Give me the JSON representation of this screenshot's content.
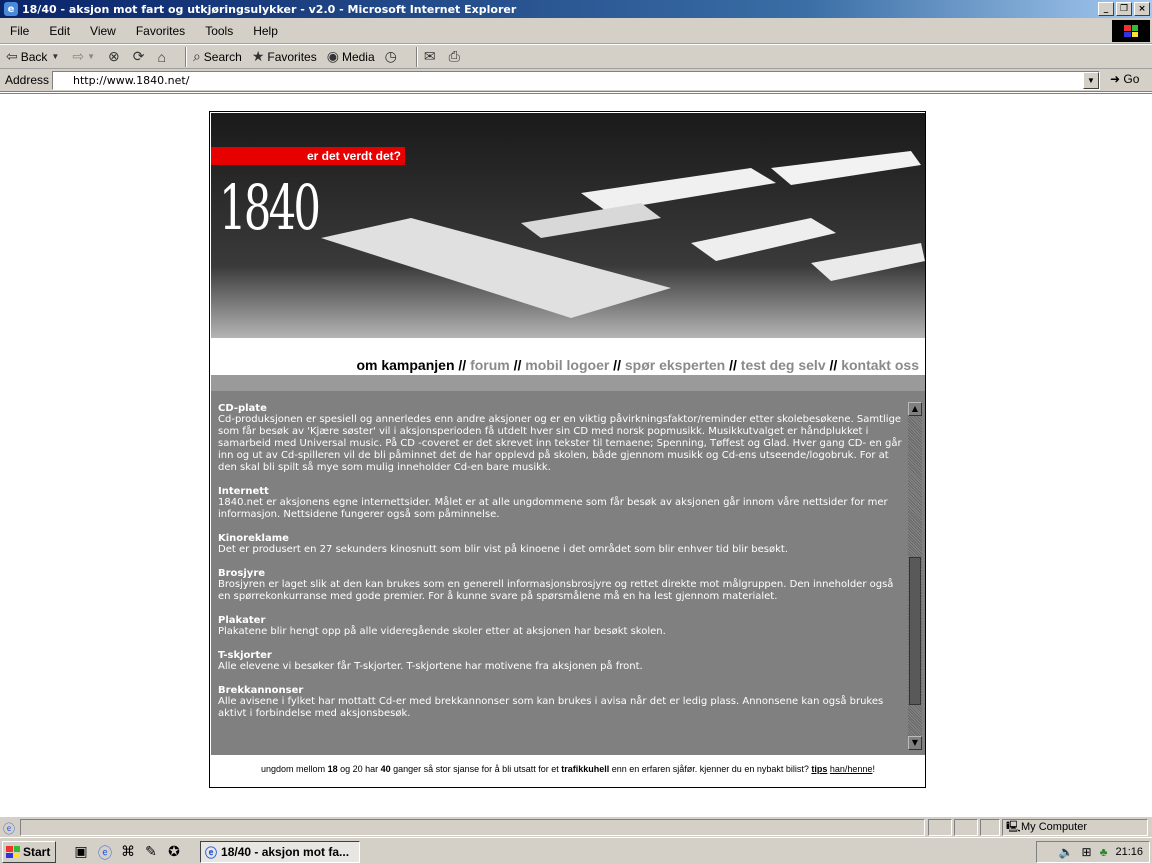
{
  "window": {
    "title": "18/40 - aksjon mot fart og utkjøringsulykker - v2.0 - Microsoft Internet Explorer",
    "controls": {
      "minimize": "_",
      "maximize": "❐",
      "close": "×"
    }
  },
  "menu": [
    "File",
    "Edit",
    "View",
    "Favorites",
    "Tools",
    "Help"
  ],
  "toolbar": {
    "back": "Back",
    "search": "Search",
    "favorites": "Favorites",
    "media": "Media"
  },
  "address": {
    "label": "Address",
    "url": "http://www.1840.net/",
    "go": "Go"
  },
  "site": {
    "slogan": "er det verdt det?",
    "logo": "1840",
    "nav": [
      {
        "label": "om kampanjen",
        "active": true
      },
      {
        "label": "forum",
        "active": false
      },
      {
        "label": "mobil logoer",
        "active": false
      },
      {
        "label": "spør eksperten",
        "active": false
      },
      {
        "label": "test deg selv",
        "active": false
      },
      {
        "label": "kontakt oss",
        "active": false
      }
    ],
    "nav_separator": "//",
    "sections": [
      {
        "title": "CD-plate",
        "body": "Cd-produksjonen er spesiell og annerledes enn andre aksjoner og er en viktig påvirkningsfaktor/reminder etter skolebesøkene. Samtlige som får besøk av 'Kjære søster' vil i aksjonsperioden få utdelt hver sin CD med norsk popmusikk. Musikkutvalget er håndplukket i samarbeid med Universal music. På CD -coveret er det skrevet inn tekster til temaene; Spenning, Tøffest og Glad. Hver gang CD- en går inn og ut av Cd-spilleren vil de bli påminnet det de har opplevd på skolen, både gjennom musikk og Cd-ens utseende/logobruk. For at den skal bli spilt så mye som mulig inneholder Cd-en bare musikk."
      },
      {
        "title": "Internett",
        "body": "1840.net er aksjonens egne internettsider. Målet er at alle ungdommene som får besøk av aksjonen går innom våre nettsider for mer informasjon. Nettsidene fungerer også som påminnelse."
      },
      {
        "title": "Kinoreklame",
        "body": "Det er produsert en 27 sekunders kinosnutt som blir vist på kinoene i det området som blir enhver tid blir besøkt."
      },
      {
        "title": "Brosjyre",
        "body": "Brosjyren er laget slik at den kan brukes som en generell informasjonsbrosjyre og rettet direkte mot målgruppen. Den inneholder også en spørrekonkurranse med gode premier. For å kunne svare på spørsmålene må en ha lest gjennom materialet."
      },
      {
        "title": "Plakater",
        "body": "Plakatene blir hengt opp på alle videregående skoler etter at aksjonen har besøkt skolen."
      },
      {
        "title": "T-skjorter",
        "body": "Alle elevene vi besøker får T-skjorter. T-skjortene har motivene fra aksjonen på front."
      },
      {
        "title": "Brekkannonser",
        "body": "Alle avisene i fylket har mottatt Cd-er med brekkannonser som kan brukes i avisa når det er ledig plass. Annonsene kan også brukes aktivt i forbindelse med aksjonsbesøk."
      }
    ],
    "footer": {
      "t1": "ungdom mellom ",
      "b1": "18",
      "t2": " og 20 har ",
      "b2": "40",
      "t3": " ganger så stor sjanse for å bli utsatt for et ",
      "b3": "trafikkuhell",
      "t4": " enn en erfaren sjåfør. kjenner du en nybakt bilist? ",
      "link1": "tips",
      "link2": "han/henne",
      "t5": "!"
    }
  },
  "status": {
    "zone": "My Computer"
  },
  "taskbar": {
    "start": "Start",
    "task": "18/40 - aksjon mot fa...",
    "clock": "21:16"
  },
  "colors": {
    "accent_red": "#e60000",
    "content_bg": "#808080",
    "nav_active": "#000000",
    "nav_inactive": "#8a8a8a"
  }
}
